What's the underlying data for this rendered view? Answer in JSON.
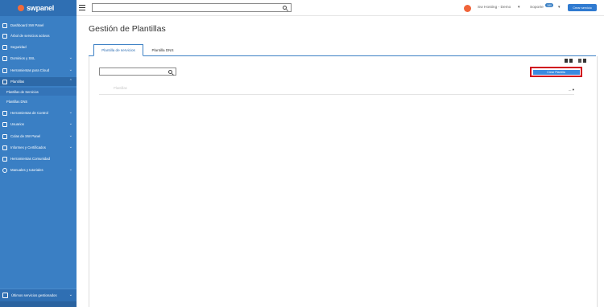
{
  "brand": {
    "name": "swpanel"
  },
  "search": {
    "placeholder": ""
  },
  "topbar": {
    "org_name": "Sw Hosting - Demo",
    "support_label": "Soporte",
    "support_badge": "180",
    "create_service_label": "Crear servicio"
  },
  "sidebar": {
    "items": [
      {
        "label": "Dashboard SW Panel",
        "icon": "dashboard-icon"
      },
      {
        "label": "Árbol de servicios activos",
        "icon": "tree-icon"
      },
      {
        "label": "Seguridad",
        "icon": "shield-icon"
      },
      {
        "label": "Dominios y SSL",
        "icon": "globe-icon"
      },
      {
        "label": "Herramientas para Cloud",
        "icon": "tools-icon"
      },
      {
        "label": "Plantillas",
        "icon": "document-icon"
      },
      {
        "label": "Herramientas de Control",
        "icon": "check-icon"
      },
      {
        "label": "Usuarios",
        "icon": "users-icon"
      },
      {
        "label": "Colas de SW Panel",
        "icon": "queue-icon"
      },
      {
        "label": "Informes y Certificados",
        "icon": "report-icon"
      },
      {
        "label": "Herramientas Comunidad",
        "icon": "community-icon"
      },
      {
        "label": "Manuales y tutoriales",
        "icon": "help-icon"
      }
    ],
    "sub_items": [
      {
        "label": "Plantillas de Servicios"
      },
      {
        "label": "Plantillas DNS"
      }
    ],
    "bottom": {
      "label": "Últimos servicios gestionados",
      "icon": "recent-icon"
    }
  },
  "main": {
    "title": "Gestión de Plantillas",
    "tabs": [
      {
        "label": "Plantilla de servicios",
        "active": true
      },
      {
        "label": "Plantilla DNS",
        "active": false
      }
    ],
    "create_template_label": "Crear Plantilla",
    "column_title": "Plantillas",
    "column_actions": "..."
  },
  "colors": {
    "sidebar": "#3a7fc4",
    "accent": "#2f7ad0",
    "highlight": "#d0021b",
    "brand_orange": "#f26b3a"
  }
}
